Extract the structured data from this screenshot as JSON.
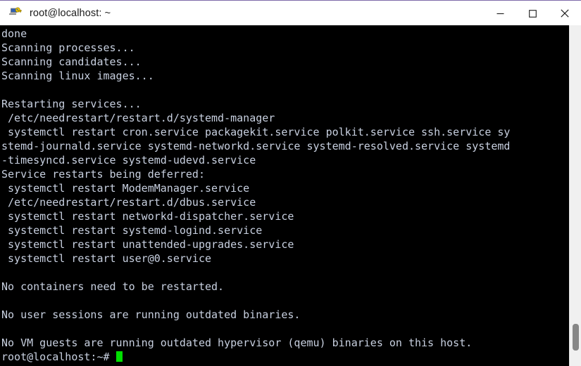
{
  "window": {
    "title": "root@localhost: ~",
    "icon": "putty-terminal-icon",
    "controls": {
      "minimize_label": "—",
      "maximize_label": "□",
      "close_label": "✕"
    },
    "colors": {
      "titlebar_bg": "#ffffff",
      "title_text": "#1b1b1b",
      "terminal_bg": "#000000",
      "terminal_fg": "#c8d0e0",
      "cursor": "#00e000",
      "scrollbar_track": "#f0f0f0",
      "scrollbar_thumb": "#868686",
      "desktop_tint": "#6b4fa8"
    }
  },
  "terminal": {
    "prompt": "root@localhost:~#",
    "cursor_visible": true,
    "lines": [
      "done",
      "Scanning processes...",
      "Scanning candidates...",
      "Scanning linux images...",
      "",
      "Restarting services...",
      " /etc/needrestart/restart.d/systemd-manager",
      " systemctl restart cron.service packagekit.service polkit.service ssh.service sy",
      "stemd-journald.service systemd-networkd.service systemd-resolved.service systemd",
      "-timesyncd.service systemd-udevd.service",
      "Service restarts being deferred:",
      " systemctl restart ModemManager.service",
      " /etc/needrestart/restart.d/dbus.service",
      " systemctl restart networkd-dispatcher.service",
      " systemctl restart systemd-logind.service",
      " systemctl restart unattended-upgrades.service",
      " systemctl restart user@0.service",
      "",
      "No containers need to be restarted.",
      "",
      "No user sessions are running outdated binaries.",
      "",
      "No VM guests are running outdated hypervisor (qemu) binaries on this host."
    ]
  }
}
